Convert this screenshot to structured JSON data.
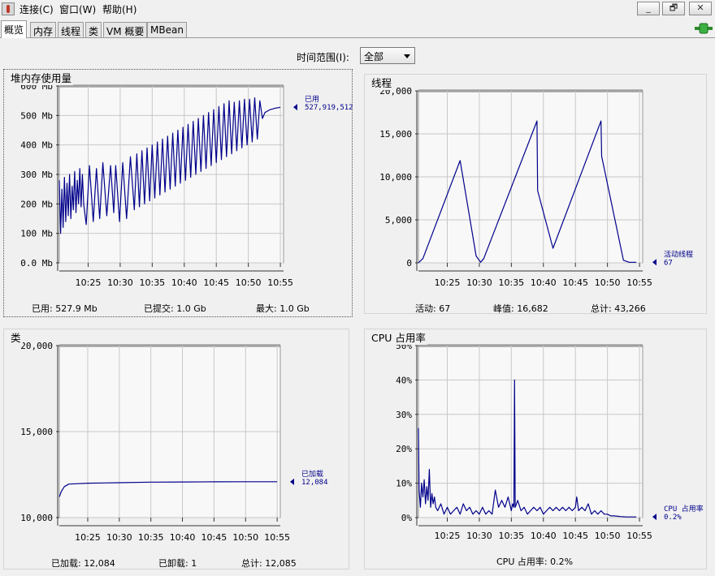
{
  "menu": {
    "items": [
      "连接(C)",
      "窗口(W)",
      "帮助(H)"
    ]
  },
  "window_buttons": {
    "minimize": "_",
    "restore": "🗗",
    "close": "✕"
  },
  "tabs": [
    {
      "label": "概览",
      "active": true
    },
    {
      "label": "内存",
      "active": false
    },
    {
      "label": "线程",
      "active": false
    },
    {
      "label": "类",
      "active": false
    },
    {
      "label": "VM 概要",
      "active": false
    },
    {
      "label": "MBean",
      "active": false
    }
  ],
  "time_range": {
    "label": "时间范围(I):",
    "value": "全部"
  },
  "colors": {
    "series": "#00008b",
    "plot_bg": "#f8f8f8",
    "grid": "#c8c8c8"
  },
  "panels": {
    "heap": {
      "title": "堆内存使用量",
      "footer": [
        {
          "label": "已用:",
          "value": "527.9  Mb"
        },
        {
          "label": "已提交:",
          "value": "1.0  Gb"
        },
        {
          "label": "最大:",
          "value": "1.0  Gb"
        }
      ]
    },
    "threads": {
      "title": "线程",
      "footer": [
        {
          "label": "活动:",
          "value": "67"
        },
        {
          "label": "峰值:",
          "value": "16,682"
        },
        {
          "label": "总计:",
          "value": "43,266"
        }
      ]
    },
    "classes": {
      "title": "类",
      "footer": [
        {
          "label": "已加载:",
          "value": "12,084"
        },
        {
          "label": "已卸载:",
          "value": "1"
        },
        {
          "label": "总计:",
          "value": "12,085"
        }
      ]
    },
    "cpu": {
      "title": "CPU 占用率",
      "footer": [
        {
          "label": "CPU 占用率:",
          "value": "0.2%"
        }
      ]
    }
  },
  "chart_data": [
    {
      "id": "heap",
      "type": "line",
      "x_ticks": [
        "10:25",
        "10:30",
        "10:35",
        "10:40",
        "10:45",
        "10:50",
        "10:55"
      ],
      "y_ticks": [
        "0.0 Mb",
        "100 Mb",
        "200 Mb",
        "300 Mb",
        "400 Mb",
        "500 Mb",
        "600 Mb"
      ],
      "ylim": [
        0,
        600
      ],
      "xlim": [
        20.5,
        55.5
      ],
      "grid": true,
      "series": [
        {
          "name": "已用",
          "value_label": "527,919,512",
          "x": [
            20.5,
            20.7,
            20.9,
            21.1,
            21.3,
            21.5,
            21.7,
            21.9,
            22.1,
            22.3,
            22.5,
            22.7,
            22.9,
            23.1,
            23.3,
            23.5,
            23.7,
            23.9,
            24.1,
            24.3,
            24.7,
            25.2,
            25.8,
            26.3,
            26.8,
            27.3,
            27.9,
            28.5,
            29.0,
            29.3,
            29.9,
            30.4,
            31.0,
            31.6,
            32.2,
            32.6,
            33.0,
            33.4,
            33.8,
            34.2,
            34.6,
            35.0,
            35.4,
            35.8,
            36.2,
            36.6,
            37.0,
            37.4,
            37.8,
            38.2,
            38.6,
            39.0,
            39.4,
            39.8,
            40.2,
            40.6,
            41.0,
            41.4,
            41.8,
            42.2,
            42.6,
            43.0,
            43.4,
            43.8,
            44.2,
            44.6,
            45.0,
            45.4,
            45.8,
            46.2,
            46.6,
            47.0,
            47.4,
            47.8,
            48.2,
            48.6,
            49.0,
            49.4,
            49.8,
            50.2,
            50.6,
            51.0,
            51.4,
            51.8,
            52.2,
            52.6,
            53.0,
            53.4,
            53.8,
            54.2,
            54.6,
            55.0
          ],
          "y": [
            280,
            100,
            250,
            120,
            290,
            140,
            270,
            160,
            300,
            150,
            260,
            180,
            310,
            170,
            280,
            200,
            320,
            190,
            300,
            200,
            130,
            330,
            140,
            320,
            150,
            340,
            160,
            330,
            170,
            330,
            140,
            340,
            150,
            360,
            180,
            370,
            190,
            380,
            200,
            390,
            210,
            400,
            220,
            410,
            230,
            420,
            240,
            430,
            250,
            440,
            260,
            450,
            270,
            460,
            280,
            470,
            290,
            480,
            300,
            490,
            310,
            500,
            320,
            510,
            330,
            520,
            340,
            530,
            350,
            540,
            360,
            550,
            370,
            545,
            380,
            550,
            390,
            555,
            400,
            555,
            410,
            560,
            420,
            550,
            490,
            510,
            515,
            520,
            522,
            525,
            526,
            528
          ]
        }
      ]
    },
    {
      "id": "threads",
      "type": "line",
      "x_ticks": [
        "10:25",
        "10:30",
        "10:35",
        "10:40",
        "10:45",
        "10:50",
        "10:55"
      ],
      "y_ticks": [
        "0",
        "5,000",
        "10,000",
        "15,000",
        "20,000"
      ],
      "ylim": [
        0,
        20000
      ],
      "xlim": [
        20.5,
        55.5
      ],
      "grid": true,
      "series": [
        {
          "name": "活动线程",
          "value_label": "67",
          "x": [
            20.5,
            21.2,
            27.0,
            29.5,
            30.2,
            30.7,
            39.0,
            39.1,
            41.5,
            49.0,
            49.1,
            52.5,
            53.4,
            54.5
          ],
          "y": [
            0,
            500,
            11900,
            800,
            67,
            500,
            16500,
            8400,
            1700,
            16500,
            12400,
            300,
            67,
            67
          ]
        }
      ]
    },
    {
      "id": "classes",
      "type": "line",
      "x_ticks": [
        "10:25",
        "10:30",
        "10:35",
        "10:40",
        "10:45",
        "10:50",
        "10:55"
      ],
      "y_ticks": [
        "10,000",
        "15,000",
        "20,000"
      ],
      "ylim": [
        10000,
        20000
      ],
      "xlim": [
        20.5,
        55.5
      ],
      "grid": true,
      "series": [
        {
          "name": "已加载",
          "value_label": "12,084",
          "x": [
            20.5,
            20.8,
            21.3,
            22.0,
            25.0,
            30.0,
            35.0,
            40.0,
            45.0,
            50.0,
            55.0
          ],
          "y": [
            11200,
            11500,
            11800,
            11950,
            12000,
            12030,
            12060,
            12070,
            12080,
            12084,
            12084
          ]
        }
      ]
    },
    {
      "id": "cpu",
      "type": "line",
      "x_ticks": [
        "10:25",
        "10:30",
        "10:35",
        "10:40",
        "10:45",
        "10:50",
        "10:55"
      ],
      "y_ticks": [
        "0%",
        "10%",
        "20%",
        "30%",
        "40%",
        "50%"
      ],
      "ylim": [
        0,
        50
      ],
      "xlim": [
        20.5,
        55.5
      ],
      "grid": true,
      "series": [
        {
          "name": "CPU 占用率",
          "value_label": "0.2%",
          "x": [
            20.5,
            20.6,
            20.8,
            21.0,
            21.2,
            21.4,
            21.6,
            21.8,
            22.0,
            22.2,
            22.4,
            22.6,
            22.8,
            23.0,
            23.2,
            23.5,
            24.0,
            24.5,
            25.0,
            25.5,
            26.0,
            26.5,
            27.0,
            27.5,
            28.0,
            28.5,
            29.0,
            29.5,
            30.0,
            30.5,
            31.0,
            31.5,
            32.0,
            32.5,
            33.0,
            33.5,
            34.0,
            34.5,
            35.0,
            35.2,
            35.4,
            35.5,
            35.6,
            35.8,
            36.0,
            36.5,
            37.0,
            37.5,
            38.0,
            38.5,
            39.0,
            39.5,
            40.0,
            40.5,
            41.0,
            41.5,
            42.0,
            42.5,
            43.0,
            43.5,
            44.0,
            44.5,
            45.0,
            45.2,
            45.5,
            46.0,
            46.5,
            47.0,
            47.5,
            48.0,
            48.5,
            49.0,
            49.5,
            50.0,
            50.5,
            51.0,
            52.0,
            53.0,
            54.0,
            54.5
          ],
          "y": [
            26,
            8,
            3,
            10,
            6,
            11,
            4,
            9,
            5,
            14,
            3,
            7,
            4,
            6,
            3,
            2,
            4,
            1,
            3,
            1,
            2,
            3,
            1,
            4,
            2,
            3,
            1,
            2,
            1,
            3,
            1,
            2,
            1,
            8,
            3,
            5,
            3,
            6,
            2,
            4,
            3,
            40,
            3,
            4,
            5,
            2,
            3,
            1,
            2,
            3,
            2,
            3,
            1,
            2,
            3,
            2,
            3,
            2,
            3,
            2,
            3,
            2,
            3,
            6,
            2,
            3,
            2,
            4,
            1,
            2,
            1,
            2,
            1,
            1,
            0.5,
            0.5,
            0.3,
            0.2,
            0.2,
            0.2
          ]
        }
      ]
    }
  ]
}
